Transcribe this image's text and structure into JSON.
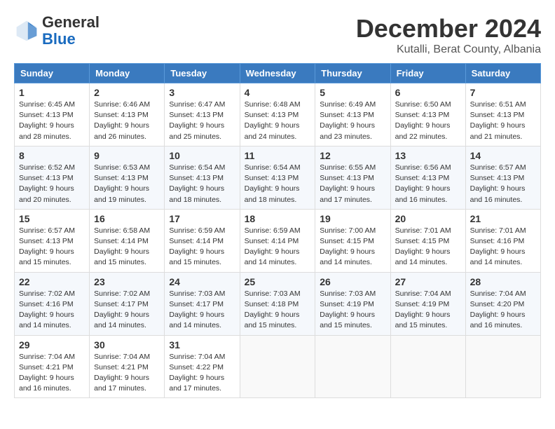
{
  "header": {
    "logo": {
      "general": "General",
      "blue": "Blue"
    },
    "title": "December 2024",
    "subtitle": "Kutalli, Berat County, Albania"
  },
  "weekdays": [
    "Sunday",
    "Monday",
    "Tuesday",
    "Wednesday",
    "Thursday",
    "Friday",
    "Saturday"
  ],
  "weeks": [
    [
      {
        "day": 1,
        "sunrise": "6:45 AM",
        "sunset": "4:13 PM",
        "daylight": "9 hours and 28 minutes."
      },
      {
        "day": 2,
        "sunrise": "6:46 AM",
        "sunset": "4:13 PM",
        "daylight": "9 hours and 26 minutes."
      },
      {
        "day": 3,
        "sunrise": "6:47 AM",
        "sunset": "4:13 PM",
        "daylight": "9 hours and 25 minutes."
      },
      {
        "day": 4,
        "sunrise": "6:48 AM",
        "sunset": "4:13 PM",
        "daylight": "9 hours and 24 minutes."
      },
      {
        "day": 5,
        "sunrise": "6:49 AM",
        "sunset": "4:13 PM",
        "daylight": "9 hours and 23 minutes."
      },
      {
        "day": 6,
        "sunrise": "6:50 AM",
        "sunset": "4:13 PM",
        "daylight": "9 hours and 22 minutes."
      },
      {
        "day": 7,
        "sunrise": "6:51 AM",
        "sunset": "4:13 PM",
        "daylight": "9 hours and 21 minutes."
      }
    ],
    [
      {
        "day": 8,
        "sunrise": "6:52 AM",
        "sunset": "4:13 PM",
        "daylight": "9 hours and 20 minutes."
      },
      {
        "day": 9,
        "sunrise": "6:53 AM",
        "sunset": "4:13 PM",
        "daylight": "9 hours and 19 minutes."
      },
      {
        "day": 10,
        "sunrise": "6:54 AM",
        "sunset": "4:13 PM",
        "daylight": "9 hours and 18 minutes."
      },
      {
        "day": 11,
        "sunrise": "6:54 AM",
        "sunset": "4:13 PM",
        "daylight": "9 hours and 18 minutes."
      },
      {
        "day": 12,
        "sunrise": "6:55 AM",
        "sunset": "4:13 PM",
        "daylight": "9 hours and 17 minutes."
      },
      {
        "day": 13,
        "sunrise": "6:56 AM",
        "sunset": "4:13 PM",
        "daylight": "9 hours and 16 minutes."
      },
      {
        "day": 14,
        "sunrise": "6:57 AM",
        "sunset": "4:13 PM",
        "daylight": "9 hours and 16 minutes."
      }
    ],
    [
      {
        "day": 15,
        "sunrise": "6:57 AM",
        "sunset": "4:13 PM",
        "daylight": "9 hours and 15 minutes."
      },
      {
        "day": 16,
        "sunrise": "6:58 AM",
        "sunset": "4:14 PM",
        "daylight": "9 hours and 15 minutes."
      },
      {
        "day": 17,
        "sunrise": "6:59 AM",
        "sunset": "4:14 PM",
        "daylight": "9 hours and 15 minutes."
      },
      {
        "day": 18,
        "sunrise": "6:59 AM",
        "sunset": "4:14 PM",
        "daylight": "9 hours and 14 minutes."
      },
      {
        "day": 19,
        "sunrise": "7:00 AM",
        "sunset": "4:15 PM",
        "daylight": "9 hours and 14 minutes."
      },
      {
        "day": 20,
        "sunrise": "7:01 AM",
        "sunset": "4:15 PM",
        "daylight": "9 hours and 14 minutes."
      },
      {
        "day": 21,
        "sunrise": "7:01 AM",
        "sunset": "4:16 PM",
        "daylight": "9 hours and 14 minutes."
      }
    ],
    [
      {
        "day": 22,
        "sunrise": "7:02 AM",
        "sunset": "4:16 PM",
        "daylight": "9 hours and 14 minutes."
      },
      {
        "day": 23,
        "sunrise": "7:02 AM",
        "sunset": "4:17 PM",
        "daylight": "9 hours and 14 minutes."
      },
      {
        "day": 24,
        "sunrise": "7:03 AM",
        "sunset": "4:17 PM",
        "daylight": "9 hours and 14 minutes."
      },
      {
        "day": 25,
        "sunrise": "7:03 AM",
        "sunset": "4:18 PM",
        "daylight": "9 hours and 15 minutes."
      },
      {
        "day": 26,
        "sunrise": "7:03 AM",
        "sunset": "4:19 PM",
        "daylight": "9 hours and 15 minutes."
      },
      {
        "day": 27,
        "sunrise": "7:04 AM",
        "sunset": "4:19 PM",
        "daylight": "9 hours and 15 minutes."
      },
      {
        "day": 28,
        "sunrise": "7:04 AM",
        "sunset": "4:20 PM",
        "daylight": "9 hours and 16 minutes."
      }
    ],
    [
      {
        "day": 29,
        "sunrise": "7:04 AM",
        "sunset": "4:21 PM",
        "daylight": "9 hours and 16 minutes."
      },
      {
        "day": 30,
        "sunrise": "7:04 AM",
        "sunset": "4:21 PM",
        "daylight": "9 hours and 17 minutes."
      },
      {
        "day": 31,
        "sunrise": "7:04 AM",
        "sunset": "4:22 PM",
        "daylight": "9 hours and 17 minutes."
      },
      null,
      null,
      null,
      null
    ]
  ]
}
